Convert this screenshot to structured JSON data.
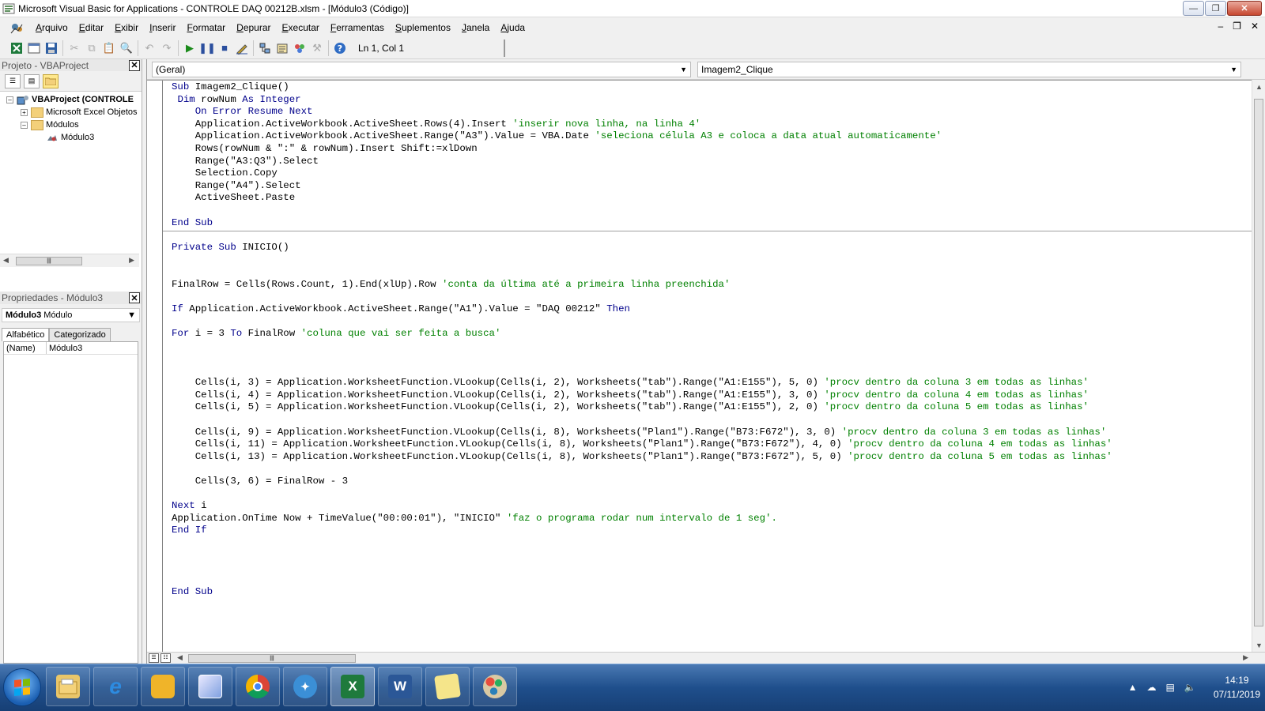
{
  "window": {
    "title": "Microsoft Visual Basic for Applications - CONTROLE DAQ 00212B.xlsm - [Módulo3 (Código)]"
  },
  "menu": {
    "items": [
      "Arquivo",
      "Editar",
      "Exibir",
      "Inserir",
      "Formatar",
      "Depurar",
      "Executar",
      "Ferramentas",
      "Suplementos",
      "Janela",
      "Ajuda"
    ]
  },
  "toolbar": {
    "position": "Ln 1, Col 1"
  },
  "project": {
    "header": "Projeto - VBAProject",
    "root": "VBAProject (CONTROLE",
    "folder_excel": "Microsoft Excel Objetos",
    "folder_modules": "Módulos",
    "module": "Módulo3"
  },
  "properties": {
    "header": "Propriedades - Módulo3",
    "object_name": "Módulo3",
    "object_type": "Módulo",
    "tab_alpha": "Alfabético",
    "tab_category": "Categorizado",
    "rows": [
      {
        "key": "(Name)",
        "value": "Módulo3"
      }
    ]
  },
  "code": {
    "object_combo": "(Geral)",
    "procedure_combo": "Imagem2_Clique",
    "lines": [
      [
        {
          "t": "Sub",
          "c": "kw"
        },
        {
          "t": " Imagem2_Clique()"
        }
      ],
      [
        {
          "t": " "
        },
        {
          "t": "Dim",
          "c": "kw"
        },
        {
          "t": " rowNum "
        },
        {
          "t": "As Integer",
          "c": "kw"
        }
      ],
      [
        {
          "t": "    "
        },
        {
          "t": "On Error Resume Next",
          "c": "kw"
        }
      ],
      [
        {
          "t": "    Application.ActiveWorkbook.ActiveSheet.Rows(4).Insert "
        },
        {
          "t": "'inserir nova linha, na linha 4'",
          "c": "cm"
        }
      ],
      [
        {
          "t": "    Application.ActiveWorkbook.ActiveSheet.Range(\"A3\").Value = VBA.Date "
        },
        {
          "t": "'seleciona célula A3 e coloca a data atual automaticamente'",
          "c": "cm"
        }
      ],
      [
        {
          "t": "    Rows(rowNum & \":\" & rowNum).Insert Shift:=xlDown"
        }
      ],
      [
        {
          "t": "    Range(\"A3:Q3\").Select"
        }
      ],
      [
        {
          "t": "    Selection.Copy"
        }
      ],
      [
        {
          "t": "    Range(\"A4\").Select"
        }
      ],
      [
        {
          "t": "    ActiveSheet.Paste"
        }
      ],
      [],
      [
        {
          "t": "End Sub",
          "c": "kw"
        }
      ],
      [],
      [
        {
          "t": "Private Sub",
          "c": "kw"
        },
        {
          "t": " INICIO()"
        }
      ],
      [],
      [],
      [
        {
          "t": "FinalRow = Cells(Rows.Count, 1).End(xlUp).Row "
        },
        {
          "t": "'conta da última até a primeira linha preenchida'",
          "c": "cm"
        }
      ],
      [],
      [
        {
          "t": "If",
          "c": "kw"
        },
        {
          "t": " Application.ActiveWorkbook.ActiveSheet.Range(\"A1\").Value = \"DAQ 00212\" "
        },
        {
          "t": "Then",
          "c": "kw"
        }
      ],
      [],
      [
        {
          "t": "For",
          "c": "kw"
        },
        {
          "t": " i = 3 "
        },
        {
          "t": "To",
          "c": "kw"
        },
        {
          "t": " FinalRow "
        },
        {
          "t": "'coluna que vai ser feita a busca'",
          "c": "cm"
        }
      ],
      [],
      [],
      [],
      [
        {
          "t": "    Cells(i, 3) = Application.WorksheetFunction.VLookup(Cells(i, 2), Worksheets(\"tab\").Range(\"A1:E155\"), 5, 0) "
        },
        {
          "t": "'procv dentro da coluna 3 em todas as linhas'",
          "c": "cm"
        }
      ],
      [
        {
          "t": "    Cells(i, 4) = Application.WorksheetFunction.VLookup(Cells(i, 2), Worksheets(\"tab\").Range(\"A1:E155\"), 3, 0) "
        },
        {
          "t": "'procv dentro da coluna 4 em todas as linhas'",
          "c": "cm"
        }
      ],
      [
        {
          "t": "    Cells(i, 5) = Application.WorksheetFunction.VLookup(Cells(i, 2), Worksheets(\"tab\").Range(\"A1:E155\"), 2, 0) "
        },
        {
          "t": "'procv dentro da coluna 5 em todas as linhas'",
          "c": "cm"
        }
      ],
      [],
      [
        {
          "t": "    Cells(i, 9) = Application.WorksheetFunction.VLookup(Cells(i, 8), Worksheets(\"Plan1\").Range(\"B73:F672\"), 3, 0) "
        },
        {
          "t": "'procv dentro da coluna 3 em todas as linhas'",
          "c": "cm"
        }
      ],
      [
        {
          "t": "    Cells(i, 11) = Application.WorksheetFunction.VLookup(Cells(i, 8), Worksheets(\"Plan1\").Range(\"B73:F672\"), 4, 0) "
        },
        {
          "t": "'procv dentro da coluna 4 em todas as linhas'",
          "c": "cm"
        }
      ],
      [
        {
          "t": "    Cells(i, 13) = Application.WorksheetFunction.VLookup(Cells(i, 8), Worksheets(\"Plan1\").Range(\"B73:F672\"), 5, 0) "
        },
        {
          "t": "'procv dentro da coluna 5 em todas as linhas'",
          "c": "cm"
        }
      ],
      [],
      [
        {
          "t": "    Cells(3, 6) = FinalRow - 3"
        }
      ],
      [],
      [
        {
          "t": "Next",
          "c": "kw"
        },
        {
          "t": " i"
        }
      ],
      [
        {
          "t": "Application.OnTime Now + TimeValue(\"00:00:01\"), \"INICIO\" "
        },
        {
          "t": "'faz o programa rodar num intervalo de 1 seg'.",
          "c": "cm"
        }
      ],
      [
        {
          "t": "End If",
          "c": "kw"
        }
      ],
      [],
      [],
      [],
      [],
      [
        {
          "t": "End Sub",
          "c": "kw"
        }
      ]
    ]
  },
  "taskbar": {
    "apps": [
      "explorer-icon",
      "ie-icon",
      "folder-icon",
      "paint-icon",
      "chrome-icon",
      "network-icon",
      "excel-icon",
      "word-icon",
      "notes-icon",
      "palette-icon"
    ],
    "time": "14:19",
    "date": "07/11/2019"
  },
  "colors": {
    "keyword": "#00008b",
    "comment": "#008000",
    "taskbar": "#1f4f8c"
  }
}
